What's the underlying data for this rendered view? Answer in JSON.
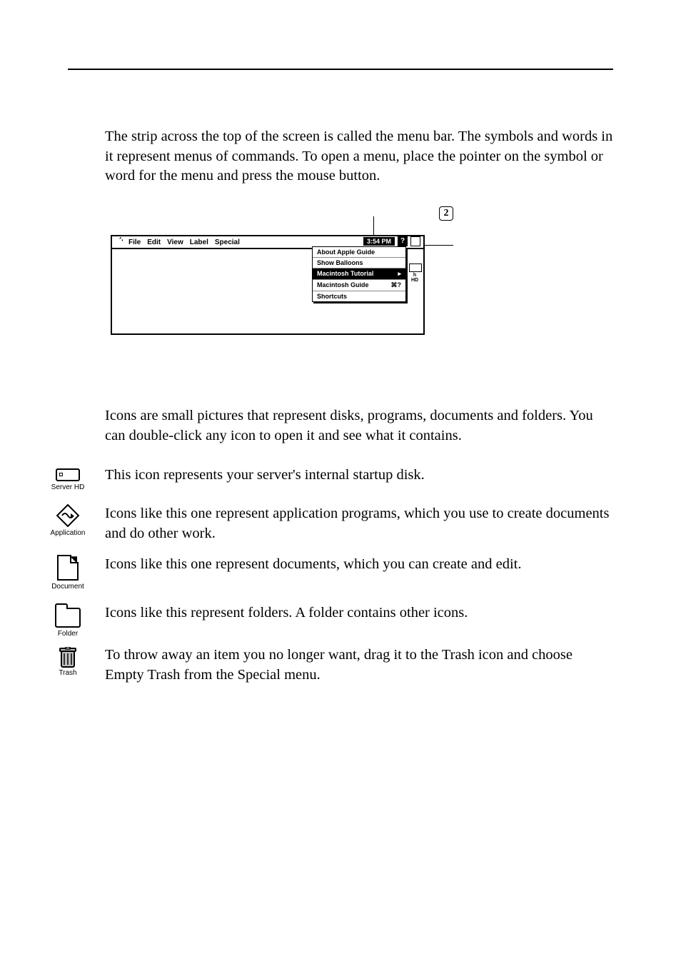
{
  "intro_para": "The strip across the top of the screen is called the menu bar. The symbols and words in it represent menus of commands. To open a menu, place the pointer on the symbol or word for the menu and press the mouse button.",
  "callout_number": "2",
  "menubar": {
    "items": [
      "File",
      "Edit",
      "View",
      "Label",
      "Special"
    ],
    "clock": "3:54 PM",
    "disk_label": "h HD"
  },
  "help_menu": {
    "about": "About Apple Guide",
    "balloons": "Show Balloons",
    "tutorial": "Macintosh Tutorial",
    "guide": "Macintosh Guide",
    "guide_shortcut": "⌘?",
    "shortcuts": "Shortcuts"
  },
  "icons_intro": "Icons are small pictures that represent disks, programs, documents and folders. You can double-click any icon to open it and see what it contains.",
  "rows": {
    "server_hd": {
      "label": "Server HD",
      "text": "This icon represents your server's internal startup disk."
    },
    "application": {
      "label": "Application",
      "text": "Icons like this one represent application programs, which you use to create documents and do other work."
    },
    "document": {
      "label": "Document",
      "text": "Icons like this one represent documents, which you can create and edit."
    },
    "folder": {
      "label": "Folder",
      "text": "Icons like this represent folders. A folder contains other icons."
    },
    "trash": {
      "label": "Trash",
      "text": "To throw away an item you no longer want, drag it to the Trash icon and choose Empty Trash from the Special menu."
    }
  }
}
